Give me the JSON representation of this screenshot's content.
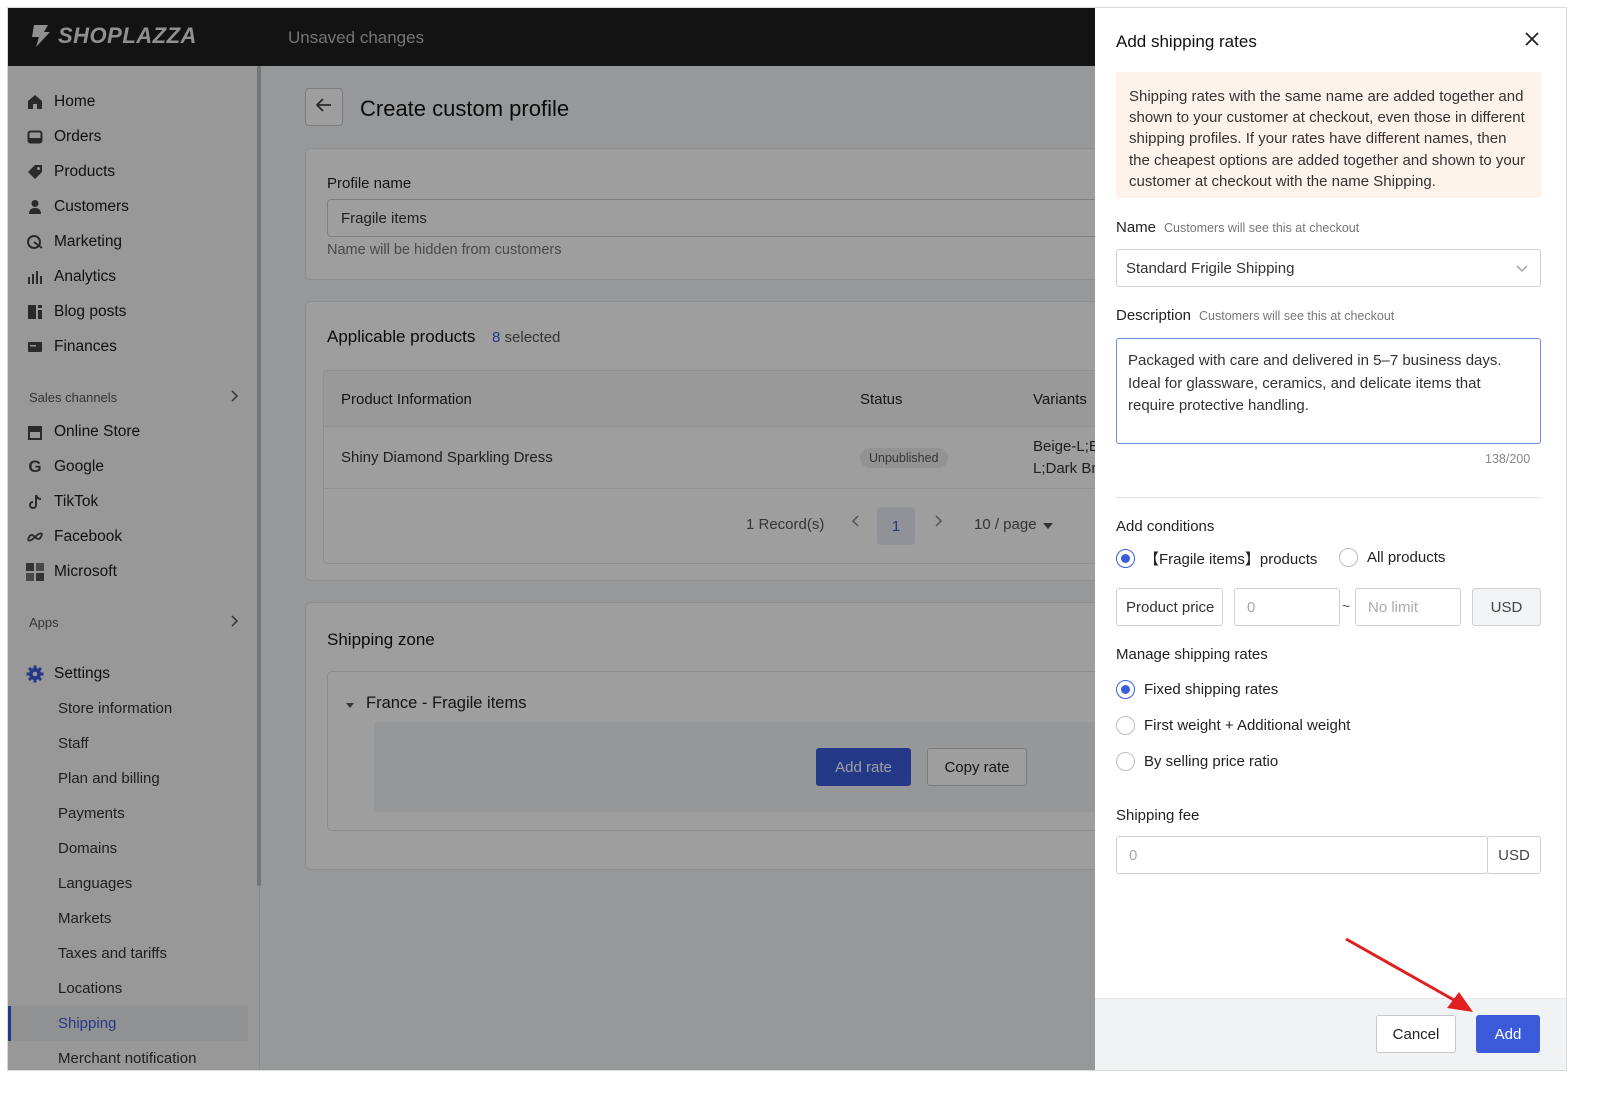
{
  "topbar": {
    "brand": "SHOPLAZZA",
    "status": "Unsaved changes"
  },
  "sidebar": {
    "main_items": [
      {
        "label": "Home",
        "icon": "home-icon"
      },
      {
        "label": "Orders",
        "icon": "orders-icon"
      },
      {
        "label": "Products",
        "icon": "tag-icon"
      },
      {
        "label": "Customers",
        "icon": "person-icon"
      },
      {
        "label": "Marketing",
        "icon": "marketing-icon"
      },
      {
        "label": "Analytics",
        "icon": "bar-chart-icon"
      },
      {
        "label": "Blog posts",
        "icon": "blog-icon"
      },
      {
        "label": "Finances",
        "icon": "finance-icon"
      }
    ],
    "sales_channels_label": "Sales channels",
    "channels": [
      {
        "label": "Online Store",
        "icon": "store-icon"
      },
      {
        "label": "Google",
        "icon": "google-icon"
      },
      {
        "label": "TikTok",
        "icon": "tiktok-icon"
      },
      {
        "label": "Facebook",
        "icon": "meta-icon"
      },
      {
        "label": "Microsoft",
        "icon": "microsoft-icon"
      }
    ],
    "apps_label": "Apps",
    "settings_label": "Settings",
    "settings_items": [
      "Store information",
      "Staff",
      "Plan and billing",
      "Payments",
      "Domains",
      "Languages",
      "Markets",
      "Taxes and tariffs",
      "Locations",
      "Shipping",
      "Merchant notification"
    ],
    "active_item": "Shipping"
  },
  "page": {
    "title": "Create custom profile",
    "profile": {
      "label": "Profile name",
      "value": "Fragile items",
      "help": "Name will be hidden from customers"
    },
    "products": {
      "title": "Applicable products",
      "selected_count": "8",
      "selected_label": "selected",
      "columns": [
        "Product Information",
        "Status",
        "Variants"
      ],
      "rows": [
        {
          "name": "Shiny Diamond Sparkling Dress",
          "status": "Unpublished",
          "variants_line1": "Beige-L;Be",
          "variants_line2": "L;Dark Bro"
        }
      ],
      "records": "1 Record(s)",
      "page": "1",
      "per_page": "10 / page"
    },
    "zone": {
      "title": "Shipping zone",
      "name": "France - Fragile items",
      "add_rate": "Add rate",
      "copy_rate": "Copy rate"
    }
  },
  "drawer": {
    "title": "Add shipping rates",
    "notice": "Shipping rates with the same name are added together and shown to your customer at checkout, even those in different shipping profiles. If your rates have different names, then the cheapest options are added together and shown to your customer at checkout with the name Shipping.",
    "name_label": "Name",
    "name_hint": "Customers will see this at checkout",
    "name_value": "Standard Frigile Shipping",
    "description_label": "Description",
    "description_hint": "Customers will see this at checkout",
    "description_value": "Packaged with care and delivered in 5–7 business days. Ideal for glassware, ceramics, and delicate items that require protective handling.",
    "char_count": "138/200",
    "conditions_label": "Add conditions",
    "condition_options": [
      "【Fragile items】products",
      "All products"
    ],
    "condition_selected": 0,
    "price_label": "Product price",
    "price_min_placeholder": "0",
    "price_separator": "~",
    "price_max_placeholder": "No limit",
    "currency": "USD",
    "manage_label": "Manage shipping rates",
    "manage_options": [
      "Fixed shipping rates",
      "First weight + Additional weight",
      "By selling price ratio"
    ],
    "manage_selected": 0,
    "fee_label": "Shipping fee",
    "fee_placeholder": "0",
    "fee_currency": "USD",
    "cancel": "Cancel",
    "add": "Add"
  },
  "colors": {
    "primary": "#3b5bdb",
    "topbar": "#1f1f1f",
    "notice_bg": "#fdf3ea",
    "arrow": "#e02020"
  }
}
